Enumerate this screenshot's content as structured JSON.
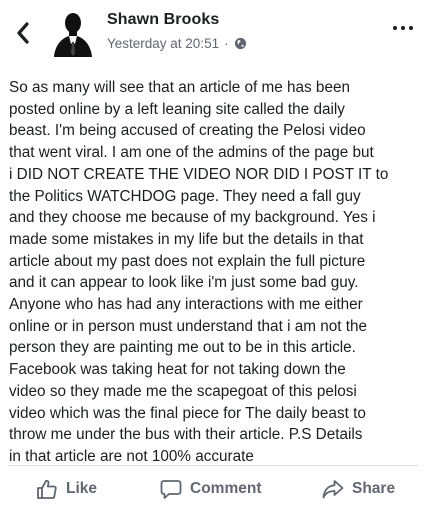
{
  "post": {
    "author": "Shawn Brooks",
    "timestamp": "Yesterday at 20:51",
    "separator": "·",
    "privacy_icon": "globe-icon",
    "text": "So as many will see that an article of me has been\nposted online by a left leaning site called the daily\nbeast. I'm being accused of creating the Pelosi video\nthat went viral. I am one of the admins of the page but\ni DID NOT CREATE THE VIDEO NOR DID I POST IT to\nthe Politics WATCHDOG page. They need a fall guy\nand they choose me because of my background. Yes i\nmade some mistakes in my life but the details in that\narticle about my past does not explain the full picture\nand it can appear to look like i'm just some bad guy.\nAnyone who has had any interactions with me either\nonline or in person must understand that i am not the\nperson they are painting me out to be in this article.\nFacebook was taking heat for not taking down the\nvideo so they made me the scapegoat of this pelosi\nvideo which was the final piece for The daily beast to\nthrow me under the bus with their article.  P.S Details\nin that article are not 100% accurate"
  },
  "actions": {
    "like_label": "Like",
    "comment_label": "Comment",
    "share_label": "Share"
  },
  "colors": {
    "text": "#1c1e21",
    "secondary": "#606770",
    "divider": "#dadde1"
  }
}
